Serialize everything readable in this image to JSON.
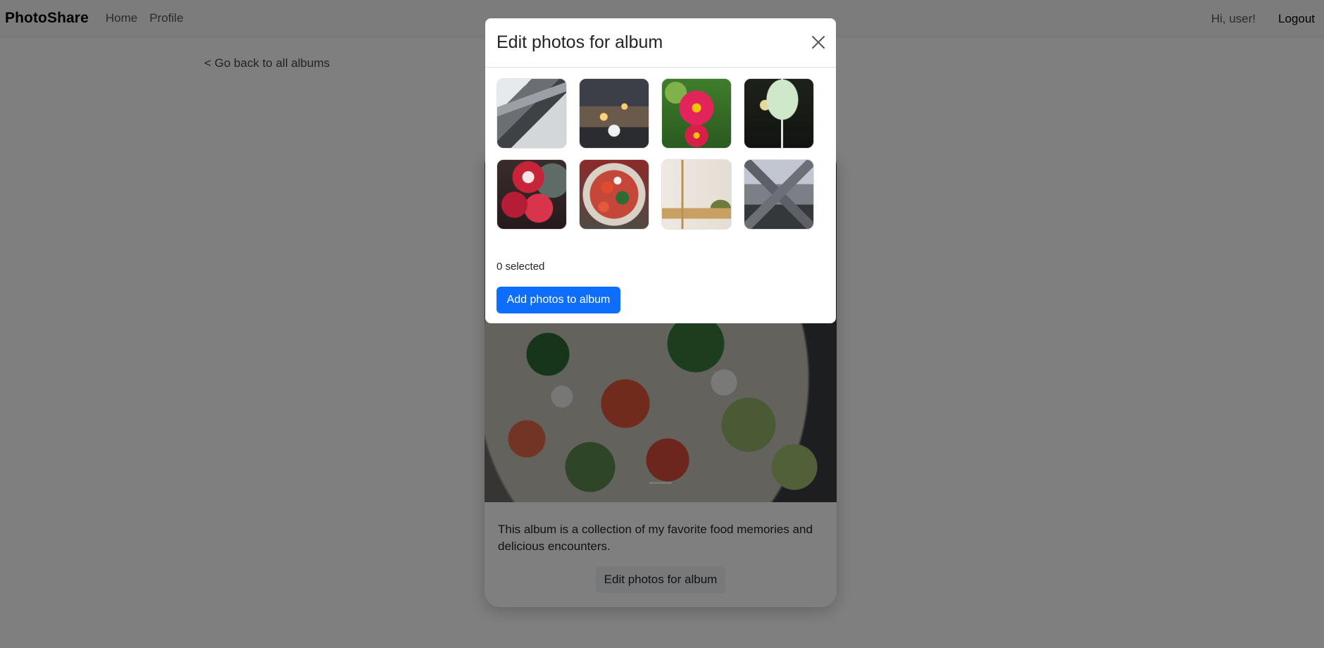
{
  "navbar": {
    "brand": "PhotoShare",
    "links": [
      "Home",
      "Profile"
    ],
    "greeting": "Hi, user!",
    "logout": "Logout"
  },
  "page": {
    "back_link": "< Go back to all albums",
    "album_description": "This album is a collection of my favorite food memories and delicious encounters.",
    "edit_button": "Edit photos for album"
  },
  "modal": {
    "title": "Edit photos for album",
    "photos": [
      {
        "subject": "snowy mountain"
      },
      {
        "subject": "city street at night"
      },
      {
        "subject": "pink flowers"
      },
      {
        "subject": "cocktail glass"
      },
      {
        "subject": "red apples"
      },
      {
        "subject": "salad bowl"
      },
      {
        "subject": "bathroom interior"
      },
      {
        "subject": "mountain peak"
      }
    ],
    "selected_count": "0 selected",
    "add_button": "Add photos to album"
  },
  "icons": {
    "close": "close-icon"
  },
  "colors": {
    "primary": "#0d6efd",
    "backdrop": "rgba(0,0,0,0.5)"
  }
}
